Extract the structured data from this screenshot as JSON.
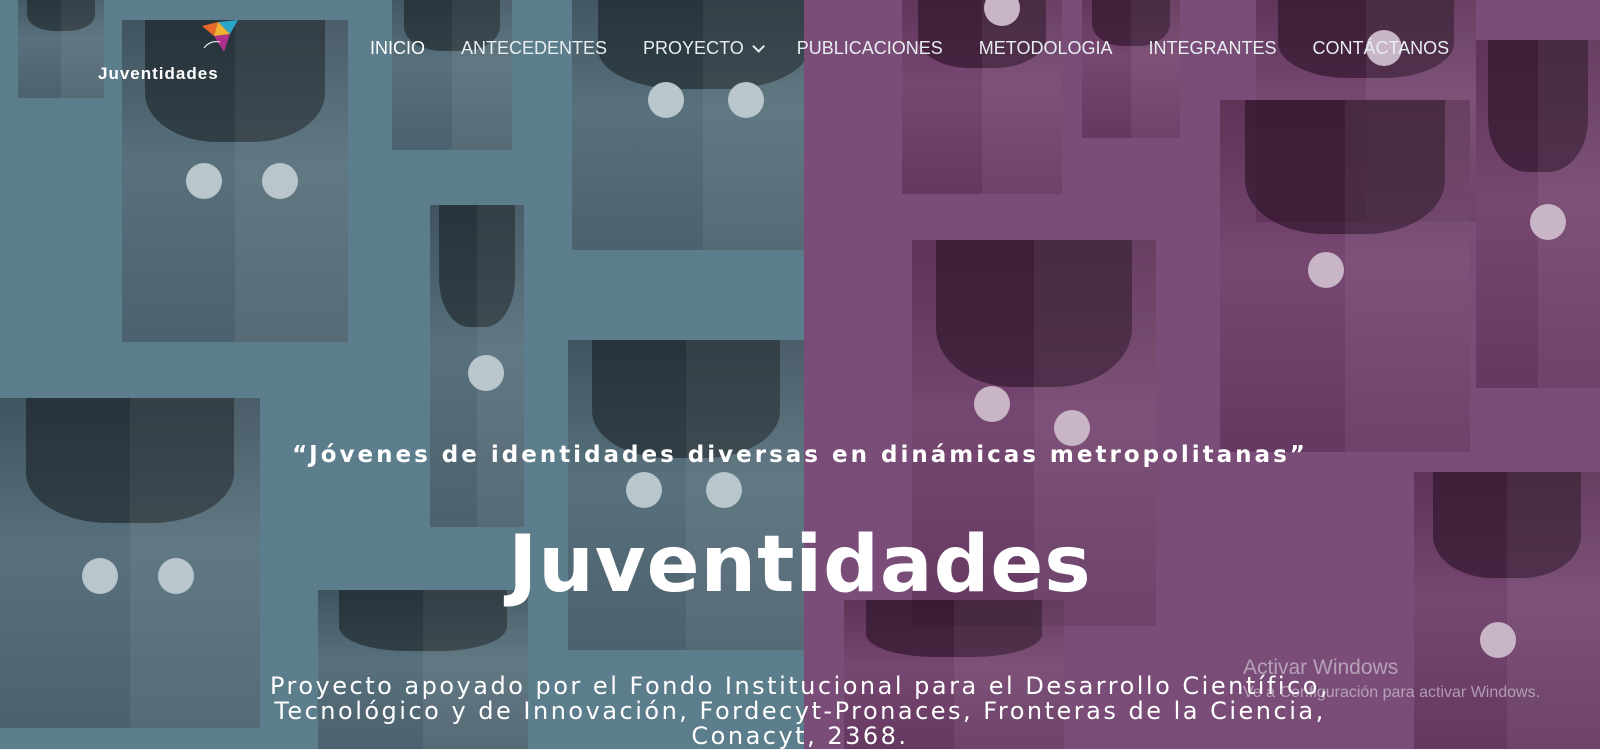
{
  "site": {
    "logo_text": "Juventidades",
    "logo_icon": "origami-bird-icon"
  },
  "nav": {
    "items": [
      {
        "label": "INICIO",
        "active": true
      },
      {
        "label": "ANTECEDENTES"
      },
      {
        "label": "PROYECTO",
        "has_dropdown": true
      },
      {
        "label": "PUBLICACIONES"
      },
      {
        "label": "METODOLOGIA"
      },
      {
        "label": "INTEGRANTES"
      },
      {
        "label": "CONTÁCTANOS"
      }
    ]
  },
  "hero": {
    "quote": "“Jóvenes de identidades diversas en dinámicas metropolitanas”",
    "title": "Juventidades",
    "subtitle": "Proyecto apoyado por el Fondo Institucional para el Desarrollo Científico, Tecnológico y de Innovación, Fordecyt-Pronaces, Fronteras de la Ciencia, Conacyt, 2368.",
    "colors": {
      "left_overlay": "#5c7d8b",
      "right_overlay": "#7a4d78"
    }
  },
  "watermark": {
    "line1": "Activar Windows",
    "line2": "Ve a Configuración para activar Windows."
  }
}
